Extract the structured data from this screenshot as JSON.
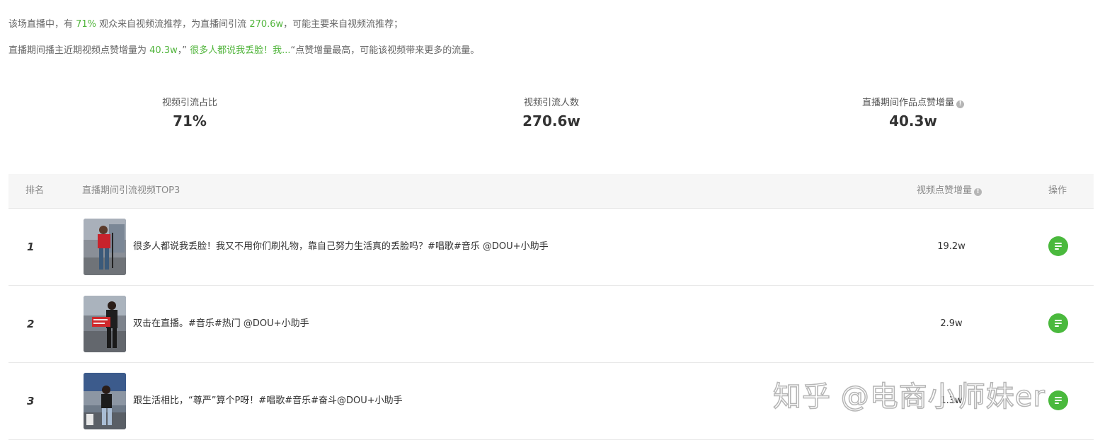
{
  "summary": {
    "line1": {
      "prefix": "该场直播中，有 ",
      "audience_pct": "71%",
      "middle": " 观众来自视频流推荐，为直播间引流 ",
      "traffic": "270.6w",
      "suffix": "，可能主要来自视频流推荐；"
    },
    "line2": {
      "prefix": "直播期间播主近期视频点赞增量为 ",
      "likes": "40.3w",
      "middle": "，”",
      "video": " 很多人都说我丢脸！我...",
      "suffix": "“点赞增量最高，可能该视频带来更多的流量。"
    }
  },
  "metrics": [
    {
      "label": "视频引流占比",
      "value": "71%"
    },
    {
      "label": "视频引流人数",
      "value": "270.6w"
    },
    {
      "label": "直播期间作品点赞增量",
      "value": "40.3w"
    }
  ],
  "table": {
    "headers": {
      "rank": "排名",
      "video": "直播期间引流视频TOP3",
      "likes": "视频点赞增量",
      "op": "操作"
    },
    "rows": [
      {
        "rank": "1",
        "title": "很多人都说我丢脸！我又不用你们刷礼物，靠自己努力生活真的丢脸吗？#唱歌#音乐 @DOU+小助手",
        "likes": "19.2w"
      },
      {
        "rank": "2",
        "title": "双击在直播。#音乐#热门 @DOU+小助手",
        "likes": "2.9w"
      },
      {
        "rank": "3",
        "title": "跟生活相比，“尊严”算个P呀！#唱歌#音乐#奋斗@DOU+小助手",
        "likes": "1.3w"
      }
    ]
  },
  "watermark": "知乎 @电商小师妹er",
  "colors": {
    "accent": "#52b53d",
    "button": "#4ab93d",
    "header_bg": "#f6f6f6"
  }
}
